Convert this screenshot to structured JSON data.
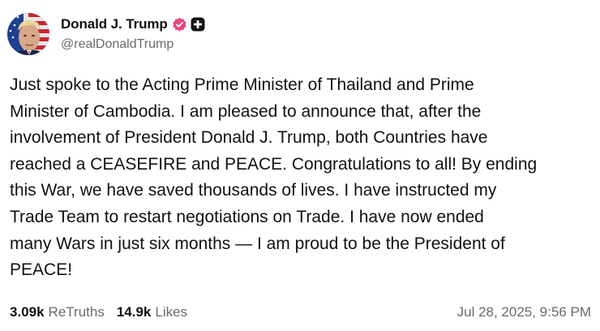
{
  "author": {
    "display_name": "Donald J. Trump",
    "handle": "@realDonaldTrump",
    "verified_color": "#e8457a"
  },
  "post": {
    "text": "Just spoke to the Acting Prime Minister of Thailand and Prime\nMinister of Cambodia. I am pleased to announce that, after the\ninvolvement of President Donald J. Trump, both Countries have\nreached a CEASEFIRE and PEACE. Congratulations to all! By ending\nthis War, we have saved thousands of lives. I have instructed my\nTrade Team to restart negotiations on Trade. I have now ended\nmany Wars in just six months — I am proud to be the President of\nPEACE!",
    "retruths_count": "3.09k",
    "retruths_label": "ReTruths",
    "likes_count": "14.9k",
    "likes_label": "Likes",
    "timestamp": "Jul 28, 2025, 9:56 PM"
  },
  "icons": {
    "verified": "verified-badge-icon",
    "plus": "plus-badge-icon"
  }
}
